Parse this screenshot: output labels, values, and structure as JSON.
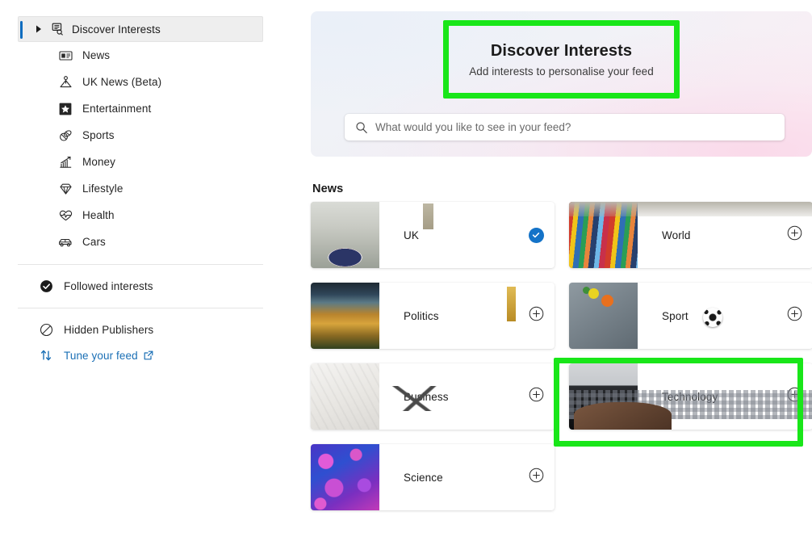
{
  "sidebar": {
    "root_item": {
      "label": "Discover Interests",
      "icon": "discover-feed-icon",
      "expander": "chevron-right-icon",
      "selected": true
    },
    "categories": [
      {
        "label": "News",
        "icon": "newspaper-icon"
      },
      {
        "label": "UK News (Beta)",
        "icon": "uk-news-icon"
      },
      {
        "label": "Entertainment",
        "icon": "star-filled-icon"
      },
      {
        "label": "Sports",
        "icon": "sports-ball-icon"
      },
      {
        "label": "Money",
        "icon": "chart-growth-icon"
      },
      {
        "label": "Lifestyle",
        "icon": "diamond-icon"
      },
      {
        "label": "Health",
        "icon": "heart-pulse-icon"
      },
      {
        "label": "Cars",
        "icon": "car-icon"
      }
    ],
    "secondary": [
      {
        "label": "Followed interests",
        "icon": "check-circle-filled-icon",
        "is_link": false
      },
      {
        "label": "Hidden Publishers",
        "icon": "block-circle-icon",
        "is_link": false
      },
      {
        "label": "Tune your feed",
        "icon": "sort-arrows-icon",
        "is_link": true,
        "external": true,
        "external_icon": "external-link-icon"
      }
    ]
  },
  "hero": {
    "title": "Discover Interests",
    "subtitle": "Add interests to personalise your feed",
    "search": {
      "placeholder": "What would you like to see in your feed?",
      "value": "",
      "icon": "search-icon"
    }
  },
  "content": {
    "section_title": "News",
    "cards": [
      {
        "label": "UK",
        "thumb": "t-uk",
        "state": "followed",
        "action_icon": "check-circle-filled-icon"
      },
      {
        "label": "World",
        "thumb": "t-world",
        "state": "add",
        "action_icon": "plus-circle-icon"
      },
      {
        "label": "Politics",
        "thumb": "t-politics",
        "state": "add",
        "action_icon": "plus-circle-icon"
      },
      {
        "label": "Sport",
        "thumb": "t-sport",
        "state": "add",
        "action_icon": "plus-circle-icon"
      },
      {
        "label": "Business",
        "thumb": "t-business",
        "state": "add",
        "action_icon": "plus-circle-icon"
      },
      {
        "label": "Technology",
        "thumb": "t-tech",
        "state": "add",
        "action_icon": "plus-circle-icon"
      },
      {
        "label": "Science",
        "thumb": "t-science",
        "state": "add",
        "action_icon": "plus-circle-icon"
      }
    ]
  },
  "annotations": {
    "highlight_color": "#19e619",
    "boxes": [
      {
        "name": "hero-title-highlight",
        "target": "Discover Interests"
      },
      {
        "name": "technology-card-highlight",
        "target": "Technology"
      }
    ]
  },
  "colors": {
    "accent_blue": "#1473c8",
    "link_blue": "#1a6fb5",
    "selection_bar": "#0d6cbf",
    "text_primary": "#1b1b1b",
    "text_secondary": "#3b3b3b"
  }
}
